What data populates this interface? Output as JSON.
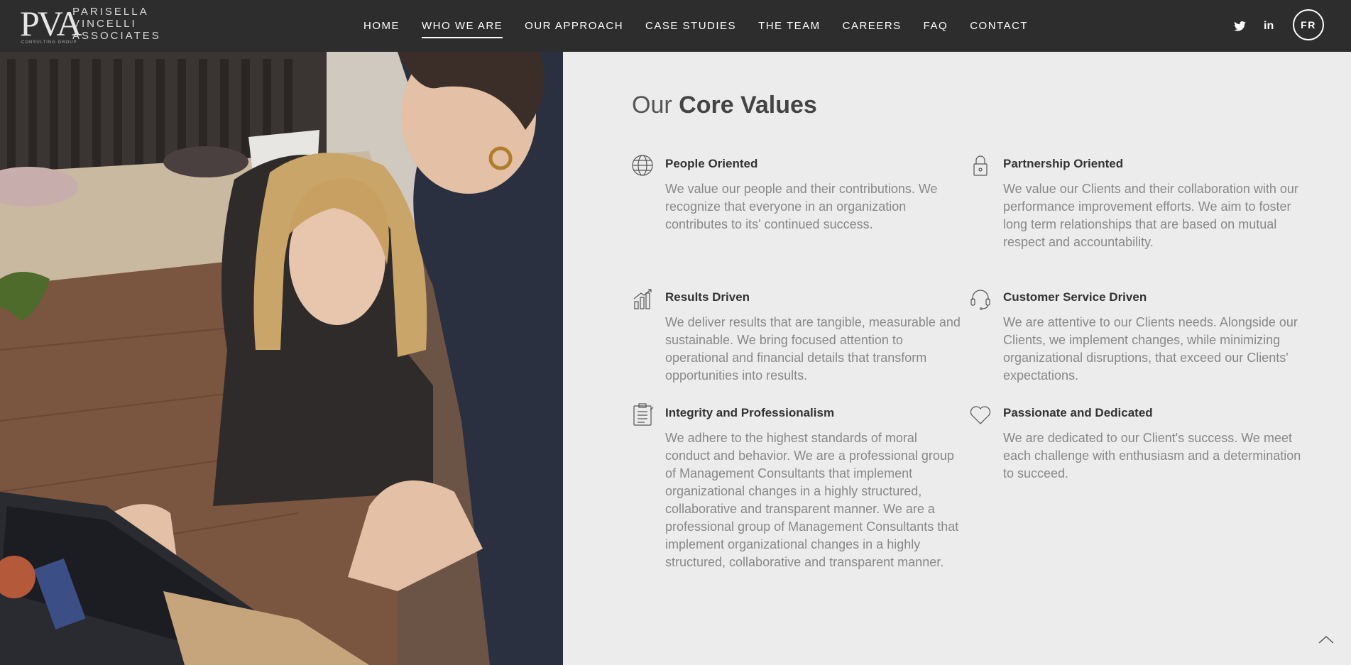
{
  "brand": {
    "mark": "PVA",
    "words": [
      "PARISELLA",
      "VINCELLI",
      "ASSOCIATES"
    ],
    "sub": "CONSULTING GROUP"
  },
  "nav": {
    "items": [
      {
        "label": "HOME"
      },
      {
        "label": "WHO WE ARE",
        "active": true
      },
      {
        "label": "OUR APPROACH"
      },
      {
        "label": "CASE STUDIES"
      },
      {
        "label": "THE TEAM"
      },
      {
        "label": "CAREERS"
      },
      {
        "label": "FAQ"
      },
      {
        "label": "CONTACT"
      }
    ],
    "social": {
      "twitter": "twitter-icon",
      "linkedin": "in"
    },
    "lang": "FR"
  },
  "section": {
    "heading_light": "Our",
    "heading_bold": "Core Values"
  },
  "values": [
    {
      "icon": "globe-icon",
      "title": "People Oriented",
      "desc": "We value our people and their contributions. We recognize that everyone in an organization contributes to its' continued success."
    },
    {
      "icon": "lock-icon",
      "title": "Partnership Oriented",
      "desc": "We value our Clients and their collaboration with our performance improvement efforts. We aim to foster long term relationships that are based on mutual respect and accountability."
    },
    {
      "icon": "bar-chart-icon",
      "title": "Results Driven",
      "desc": "We deliver results that are tangible, measurable and sustainable. We bring focused attention to operational and financial details that transform opportunities into results."
    },
    {
      "icon": "headset-icon",
      "title": "Customer Service Driven",
      "desc": "We are attentive to our Clients needs. Alongside our Clients, we implement changes, while minimizing organizational disruptions, that exceed our Clients' expectations."
    },
    {
      "icon": "clipboard-icon",
      "title": "Integrity and Professionalism",
      "desc": "We adhere to the highest standards of moral conduct and behavior. We are a professional group of Management Consultants that implement organizational changes in a highly structured, collaborative and transparent manner. We are a professional group of Management Consultants that implement organizational changes in a highly structured, collaborative and transparent manner."
    },
    {
      "icon": "heart-icon",
      "title": "Passionate and Dedicated",
      "desc": "We are dedicated to our Client's success. We meet each challenge with enthusiasm and a determination to succeed."
    }
  ],
  "colors": {
    "nav_bg": "#2d2d2d",
    "content_bg": "#ececec",
    "text": "#333333",
    "muted": "#888888"
  }
}
